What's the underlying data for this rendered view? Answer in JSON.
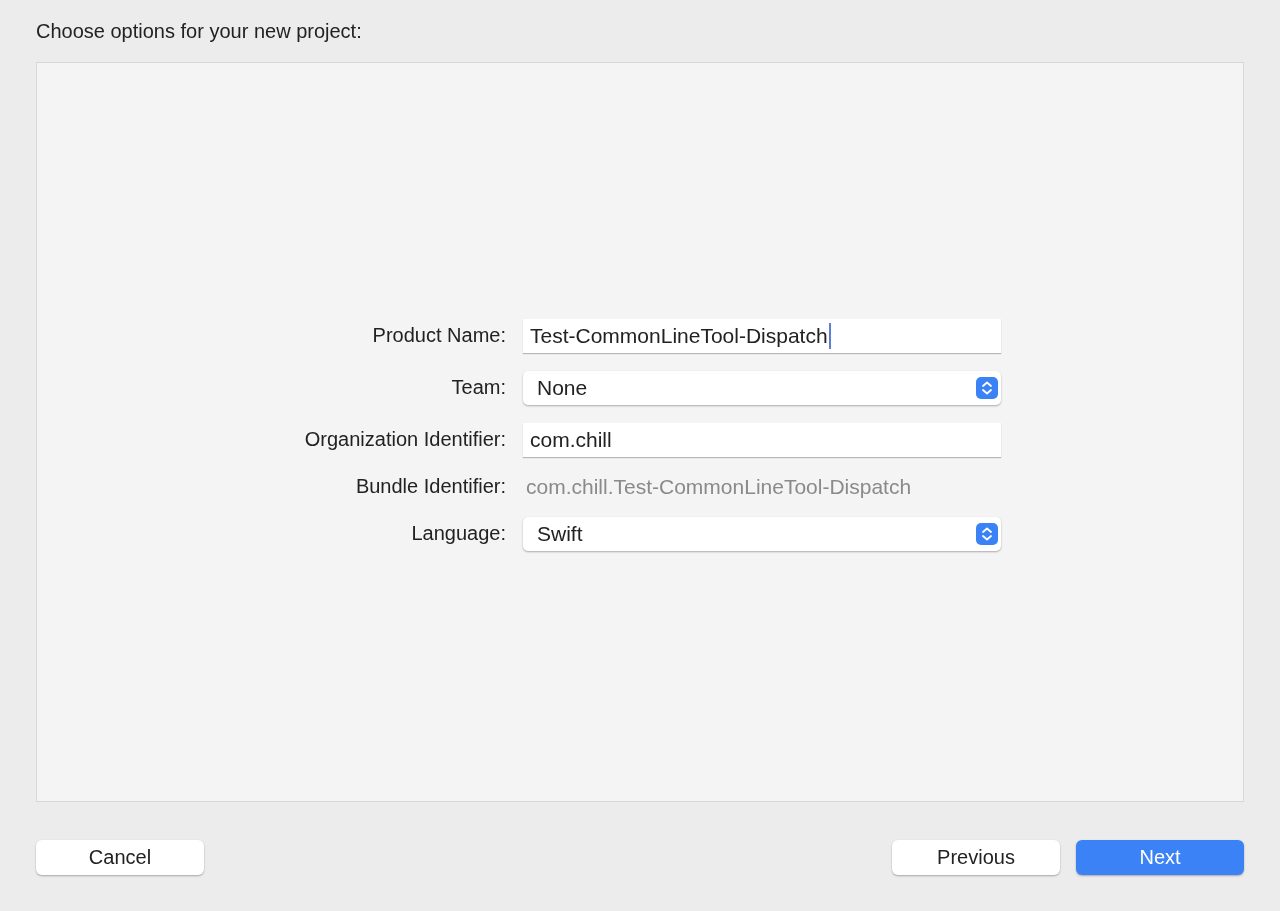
{
  "heading": "Choose options for your new project:",
  "fields": [
    {
      "kind": "text",
      "label": "Product Name:",
      "value": "Test-CommonLineTool-Dispatch",
      "focused": true
    },
    {
      "kind": "popup",
      "label": "Team:",
      "value": "None"
    },
    {
      "kind": "text",
      "label": "Organization Identifier:",
      "value": "com.chill"
    },
    {
      "kind": "static",
      "label": "Bundle Identifier:",
      "value": "com.chill.Test-CommonLineTool-Dispatch"
    },
    {
      "kind": "popup",
      "label": "Language:",
      "value": "Swift"
    }
  ],
  "buttons": [
    {
      "kind": "normal",
      "label": "Cancel"
    },
    {
      "kind": "spacer"
    },
    {
      "kind": "normal",
      "label": "Previous"
    },
    {
      "kind": "primary",
      "label": "Next"
    }
  ]
}
